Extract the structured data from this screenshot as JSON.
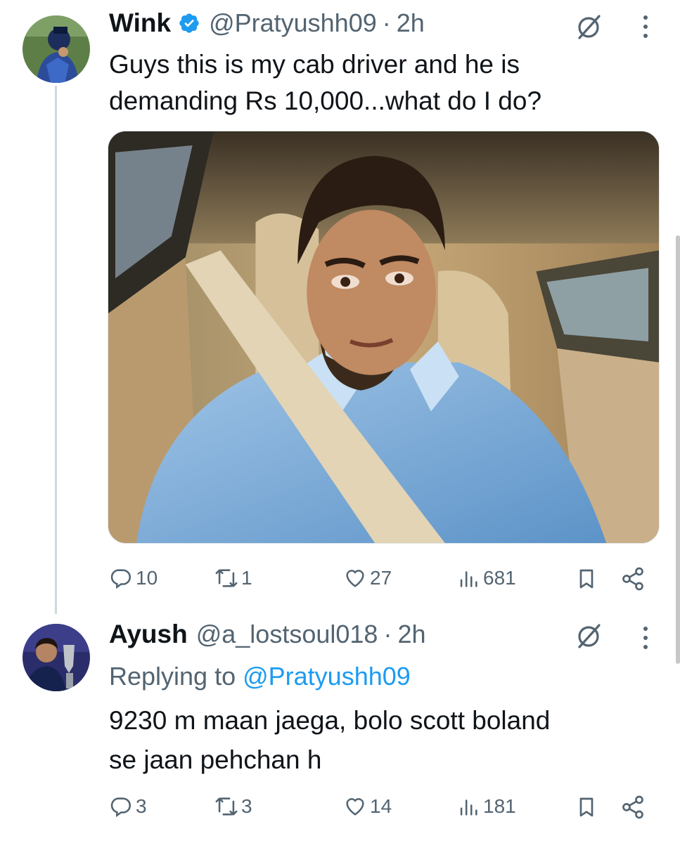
{
  "tweet": {
    "author_name": "Wink",
    "handle": "@Pratyushh09",
    "separator": "·",
    "time": "2h",
    "text_line1": "Guys this is my cab driver and he is",
    "text_line2": "demanding Rs 10,000...what do I do?",
    "actions": {
      "replies": "10",
      "retweets": "1",
      "likes": "27",
      "views": "681"
    }
  },
  "reply": {
    "author_name": "Ayush",
    "handle": "@a_lostsoul018",
    "separator": "·",
    "time": "2h",
    "replying_prefix": "Replying to ",
    "replying_to": "@Pratyushh09",
    "text_line1": "9230 m maan jaega, bolo scott boland",
    "text_line2": "se jaan pehchan h",
    "actions": {
      "replies": "3",
      "retweets": "3",
      "likes": "14",
      "views": "181"
    }
  },
  "colors": {
    "primary_text": "#0f1419",
    "secondary_text": "#536471",
    "link": "#1d9bf0",
    "verified": "#1d9bf0",
    "thread_line": "#cfd9de"
  },
  "icons": [
    "verified-badge-icon",
    "grok-icon",
    "more-icon",
    "reply-icon",
    "retweet-icon",
    "like-icon",
    "views-icon",
    "bookmark-icon",
    "share-icon"
  ]
}
